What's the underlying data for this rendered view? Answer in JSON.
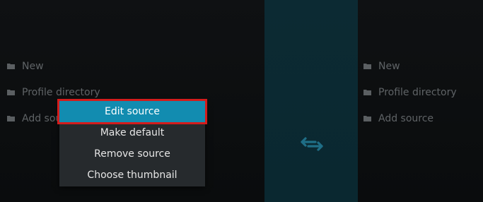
{
  "left_list": {
    "items": [
      {
        "label": "New",
        "icon": "folder-icon"
      },
      {
        "label": "Profile directory",
        "icon": "folder-icon"
      },
      {
        "label": "Add source",
        "icon": "folder-icon"
      }
    ]
  },
  "right_list": {
    "items": [
      {
        "label": "New",
        "icon": "folder-icon"
      },
      {
        "label": "Profile directory",
        "icon": "folder-icon"
      },
      {
        "label": "Add source",
        "icon": "folder-icon"
      }
    ]
  },
  "context_menu": {
    "items": [
      {
        "label": "Edit source",
        "selected": true
      },
      {
        "label": "Make default",
        "selected": false
      },
      {
        "label": "Remove source",
        "selected": false
      },
      {
        "label": "Choose thumbnail",
        "selected": false
      }
    ]
  },
  "center": {
    "icon": "swap-arrows-icon"
  },
  "colors": {
    "accent": "#128cb0",
    "highlight_outline": "#d41c1c",
    "menu_bg": "#262a2d",
    "center_panel": "#0c2a33"
  }
}
